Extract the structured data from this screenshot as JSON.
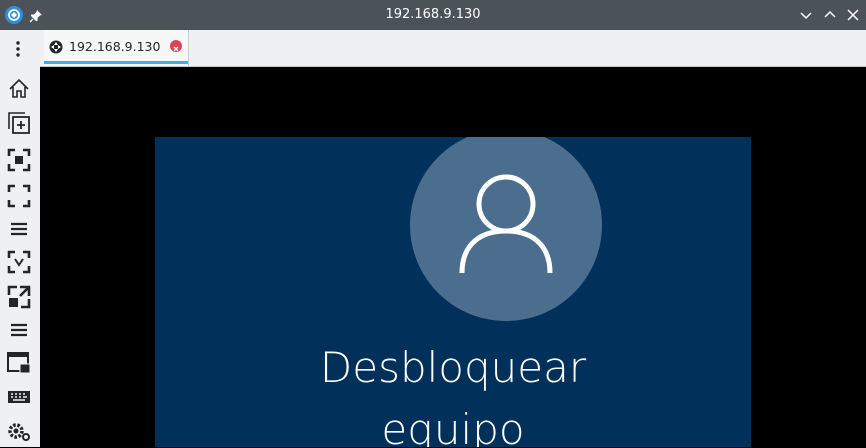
{
  "window": {
    "title": "192.168.9.130",
    "app_icon": "remmina-app-icon",
    "pin_icon": "pin-icon",
    "controls": [
      "minimize-icon",
      "maximize-icon",
      "close-icon"
    ]
  },
  "tabbar": {
    "menu_icon": "vertical-dots-icon",
    "tabs": [
      {
        "label": "192.168.9.130",
        "icon": "remote-connection-icon",
        "close_icon": "tab-close-icon"
      }
    ]
  },
  "toolbar": {
    "items": [
      {
        "name": "home-icon"
      },
      {
        "name": "new-window-icon"
      },
      {
        "name": "fit-window-icon"
      },
      {
        "name": "fullscreen-icon"
      },
      {
        "name": "menu-icon"
      },
      {
        "name": "scale-icon"
      },
      {
        "name": "scaling-toggle-icon"
      },
      {
        "name": "menu-icon-2"
      },
      {
        "name": "grab-input-icon"
      },
      {
        "name": "keyboard-icon"
      },
      {
        "name": "settings-icon"
      }
    ]
  },
  "remote": {
    "background_color": "#01305a",
    "avatar_icon": "user-avatar-icon",
    "unlock_line1": "Desbloquear",
    "unlock_line2": "equipo"
  }
}
